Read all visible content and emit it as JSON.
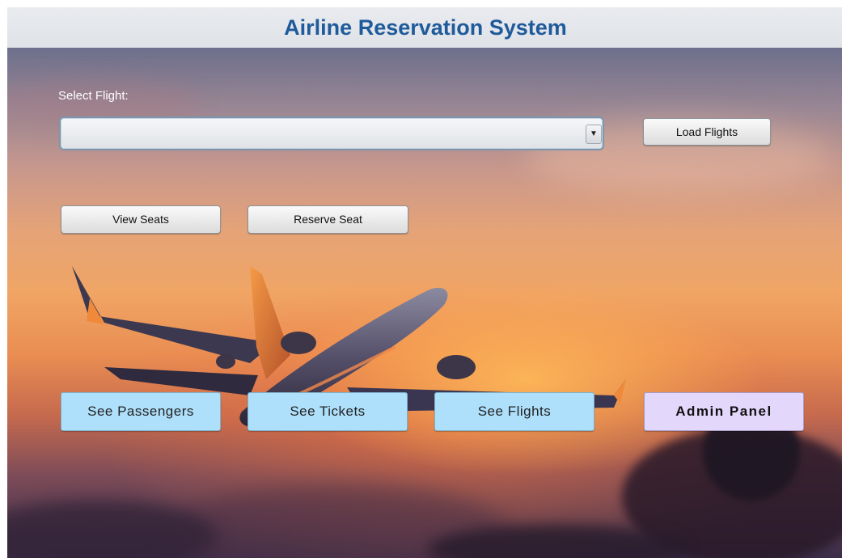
{
  "app": {
    "title": "Airline Reservation System"
  },
  "flight_select": {
    "label": "Select Flight:",
    "value": ""
  },
  "buttons": {
    "load_flights": "Load Flights",
    "view_seats": "View Seats",
    "reserve_seat": "Reserve Seat",
    "see_passengers": "See Passengers",
    "see_tickets": "See Tickets",
    "see_flights": "See Flights",
    "admin_panel": "Admin Panel"
  },
  "colors": {
    "title": "#1f5b9b",
    "primary_button": "#aee0fb",
    "admin_button": "#e3d7fb"
  },
  "icons": {
    "combo_arrow": "chevron-down-icon",
    "background": "airplane-sunset-image"
  }
}
